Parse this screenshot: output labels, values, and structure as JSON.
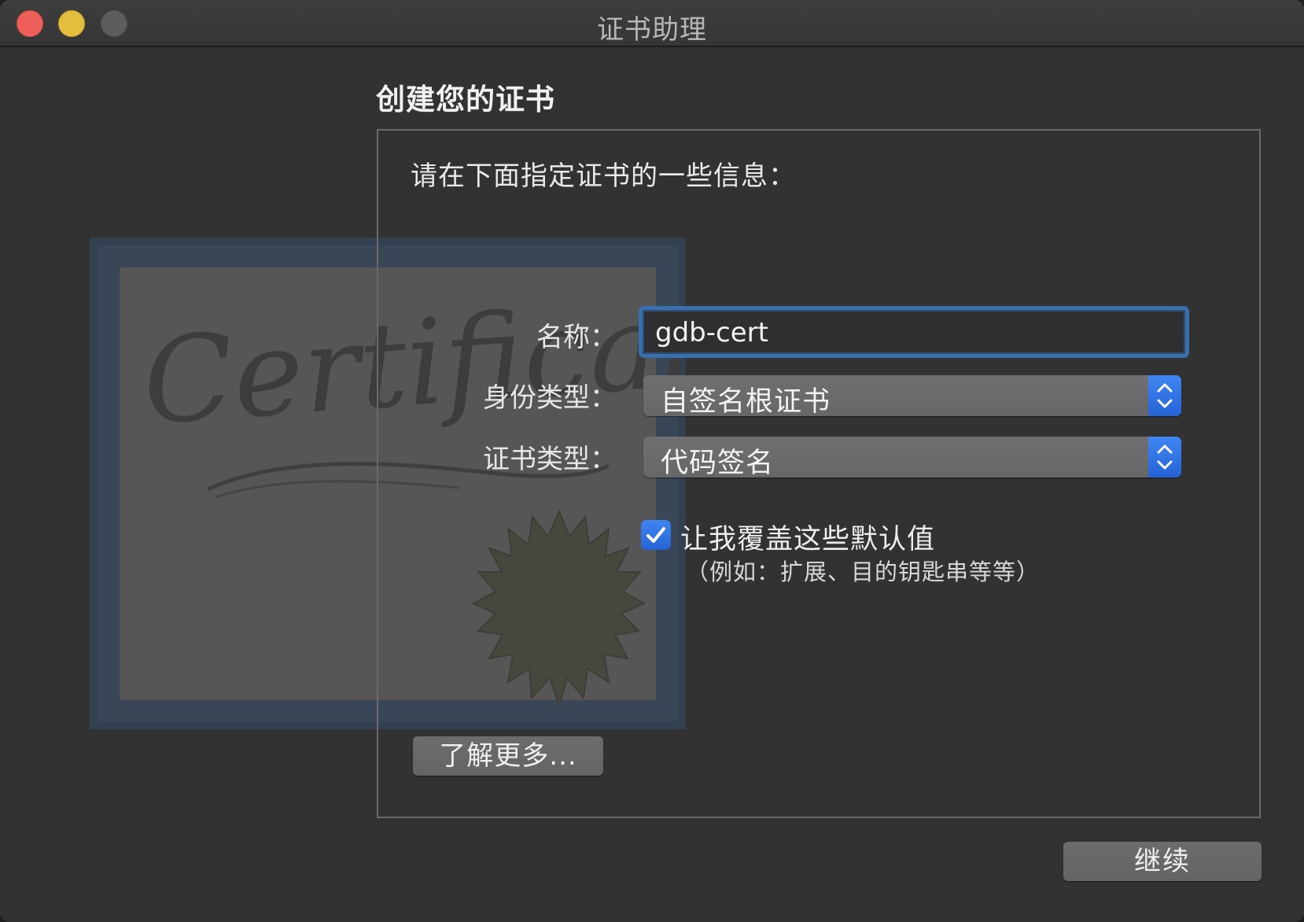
{
  "window": {
    "title": "证书助理"
  },
  "page": {
    "heading": "创建您的证书",
    "intro": "请在下面指定证书的一些信息："
  },
  "art": {
    "certificate_word": "Certificate"
  },
  "form": {
    "name_label": "名称：",
    "name_value": "gdb-cert",
    "identity_type_label": "身份类型：",
    "identity_type_value": "自签名根证书",
    "certificate_type_label": "证书类型：",
    "certificate_type_value": "代码签名",
    "override_checked": true,
    "override_label": "让我覆盖这些默认值",
    "override_hint": "（例如：扩展、目的钥匙串等等）"
  },
  "buttons": {
    "learn_more": "了解更多...",
    "continue": "继续"
  },
  "colors": {
    "window_bg": "#323233",
    "accent_blue": "#2f74e6",
    "focus_ring": "#3a6fae",
    "close": "#ed5f58",
    "minimize": "#e3bd3d",
    "zoom_disabled": "#5d5d5f"
  }
}
